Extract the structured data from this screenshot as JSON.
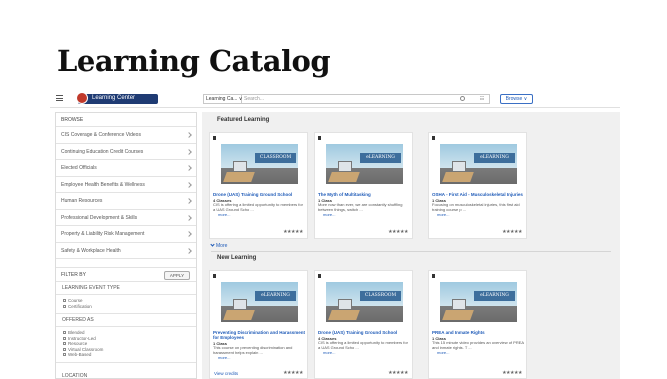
{
  "slide": {
    "title": "Learning Catalog"
  },
  "header": {
    "logo_text": "Learning Center",
    "search_scope": "Learning Ca... ∨",
    "search_placeholder": "Search...",
    "browse_label": "Browse ∨"
  },
  "sidebar": {
    "browse_title": "BROWSE",
    "items": [
      {
        "label": "CIS Coverage & Conference Videos"
      },
      {
        "label": "Continuing Education Credit Courses"
      },
      {
        "label": "Elected Officials"
      },
      {
        "label": "Employee Health Benefits & Wellness"
      },
      {
        "label": "Human Resources"
      },
      {
        "label": "Professional Development & Skills"
      },
      {
        "label": "Property & Liability Risk Management"
      },
      {
        "label": "Safety & Workplace Health"
      }
    ],
    "filter_by": "FILTER BY",
    "apply_label": "APPLY",
    "event_type_title": "LEARNING EVENT TYPE",
    "event_types": [
      "Course",
      "Certification"
    ],
    "offered_as_title": "OFFERED AS",
    "offered_as": [
      "Blended",
      "Instructor-Led",
      "Resource",
      "Virtual Classroom",
      "Web-Based"
    ],
    "location_title": "LOCATION"
  },
  "featured": {
    "title": "Featured Learning",
    "more_label": "More",
    "cards": [
      {
        "thumb_label": "CLASSROOM",
        "title": "Drone (UAS) Training Ground School",
        "count": "4 Classes",
        "desc": "CIS is offering a limited opportunity to members for a UAS Ground Scho ...",
        "more": "more...",
        "stars": "★★★★★"
      },
      {
        "thumb_label": "eLEARNING",
        "title": "The Myth of Multitasking",
        "count": "1 Class",
        "desc": "More now than ever, we are constantly shuffling between things, switch ...",
        "more": "more...",
        "stars": "★★★★★"
      },
      {
        "thumb_label": "eLEARNING",
        "title": "OSHA - First Aid - Musculoskeletal Injuries",
        "count": "1 Class",
        "desc": "Focusing on musculoskeletal injuries, this first aid training course p ...",
        "more": "more...",
        "stars": "★★★★★"
      }
    ]
  },
  "new_learning": {
    "title": "New Learning",
    "cards": [
      {
        "thumb_label": "eLEARNING",
        "title": "Preventing Discrimination and Harassment for Employees",
        "count": "1 Class",
        "desc": "This course on preventing discrimination and harassment helps explain ...",
        "more": "more...",
        "extra": "View credits",
        "stars": "★★★★★"
      },
      {
        "thumb_label": "CLASSROOM",
        "title": "Drone (UAS) Training Ground School",
        "count": "4 Classes",
        "desc": "CIS is offering a limited opportunity to members for a UAS Ground Scho ...",
        "more": "more...",
        "stars": "★★★★★"
      },
      {
        "thumb_label": "eLEARNING",
        "title": "PREA and Inmate Rights",
        "count": "1 Class",
        "desc": "This 15 minute video provides an overview of PREA and inmate rights. T ...",
        "more": "more...",
        "stars": "★★★★★"
      }
    ]
  },
  "colors": {
    "brand": "#1f3b73",
    "link": "#1f5bb8",
    "background": "#f0f0f0"
  }
}
